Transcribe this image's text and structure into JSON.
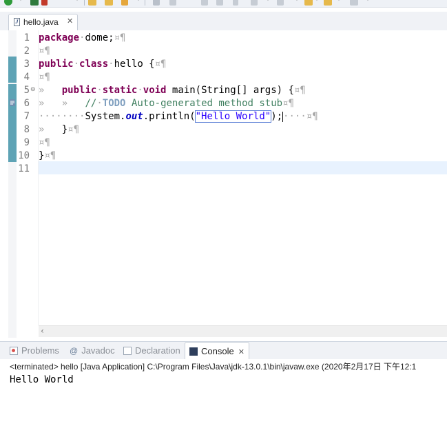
{
  "editor": {
    "tab": {
      "label": "hello.java",
      "file_icon_glyph": "J"
    },
    "line_numbers": [
      "1",
      "2",
      "3",
      "4",
      "5",
      "6",
      "7",
      "8",
      "9",
      "10",
      "11"
    ],
    "code": {
      "l1_kw": "package",
      "l1_rest": "dome;",
      "l3_kw1": "public",
      "l3_kw2": "class",
      "l3_rest": "hello {",
      "l5_kw1": "public",
      "l5_kw2": "static",
      "l5_kw3": "void",
      "l5_rest": "main(String[] args) {",
      "l6_comment_start": "//",
      "l6_todo": "TODO",
      "l6_comment_rest": "Auto-generated method stub",
      "l7_obj": "System.",
      "l7_field": "out",
      "l7_method": ".println(",
      "l7_string": "\"Hello World\"",
      "l7_end": ");",
      "l8_brace": "}",
      "l10_brace": "}"
    },
    "whitespace": {
      "pilcrow": "¤¶",
      "tab": "»",
      "space": "·"
    }
  },
  "views": {
    "tabs": [
      {
        "label": "Problems",
        "icon": "problems-icon",
        "active": false
      },
      {
        "label": "Javadoc",
        "icon": "javadoc-icon",
        "active": false
      },
      {
        "label": "Declaration",
        "icon": "declaration-icon",
        "active": false
      },
      {
        "label": "Console",
        "icon": "console-icon",
        "active": true
      }
    ],
    "javadoc_glyph": "@"
  },
  "console": {
    "header": "<terminated> hello [Java Application] C:\\Program Files\\Java\\jdk-13.0.1\\bin\\javaw.exe (2020年2月17日 下午12:1",
    "output": "Hello World"
  },
  "colors": {
    "keyword": "#7f0055",
    "comment": "#3f7f5f",
    "string": "#2a00ff",
    "field": "#0000c0",
    "current_line": "#e8f2fe",
    "ruler_mark": "#5ea3b5"
  }
}
